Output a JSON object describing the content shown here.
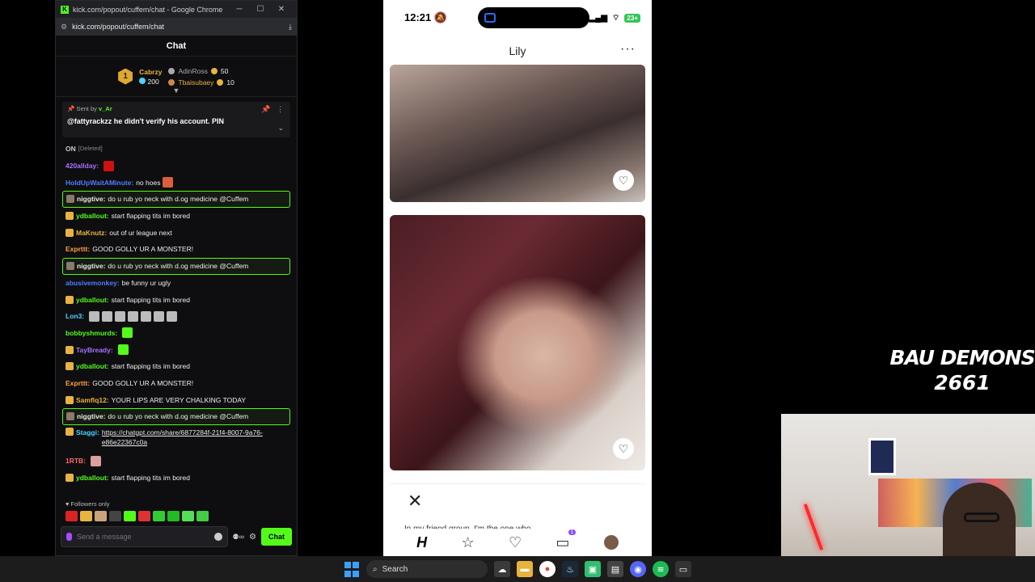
{
  "browser": {
    "window_title": "kick.com/popout/cuffem/chat - Google Chrome",
    "url": "kick.com/popout/cuffem/chat"
  },
  "chat": {
    "header": "Chat",
    "gifters": {
      "top": {
        "rank": "1",
        "name": "Cabrzy",
        "count": "200"
      },
      "others": [
        {
          "name": "AdinRoss",
          "count": "50"
        },
        {
          "name": "Tbaisubaey",
          "count": "10"
        }
      ]
    },
    "pinned": {
      "sent_by_label": "Sent by",
      "sent_by": "v_Ar",
      "text": "@fattyrackzz he didn't verify his account. PIN"
    },
    "messages": [
      {
        "user": "ON",
        "text": "[Deleted]",
        "color": "#cccccc"
      },
      {
        "user": "420allday:",
        "text": "",
        "color": "#a970ff"
      },
      {
        "user": "HoldUpWaitAMinute:",
        "text": "no hoes",
        "color": "#4f7cff"
      },
      {
        "user": "niggtive:",
        "text": "do u rub yo neck with d.og medicine @Cuffem",
        "color": "#e8e8e8",
        "highlight": true
      },
      {
        "user": "ydballout:",
        "text": "start flapping tits im bored",
        "color": "#53fc18"
      },
      {
        "user": "MaKnutz:",
        "text": "out of ur league next",
        "color": "#e7b342"
      },
      {
        "user": "Exprttt:",
        "text": "GOOD GOLLY UR A MONSTER!",
        "color": "#ff9f43"
      },
      {
        "user": "niggtive:",
        "text": "do u rub yo neck with d.og medicine @Cuffem",
        "color": "#e8e8e8",
        "highlight": true
      },
      {
        "user": "abusivemonkey:",
        "text": "be funny ur ugly",
        "color": "#4f7cff"
      },
      {
        "user": "ydballout:",
        "text": "start flapping tits im bored",
        "color": "#53fc18"
      },
      {
        "user": "Lon3:",
        "text": "",
        "color": "#4fd1ff"
      },
      {
        "user": "bobbyshmurds:",
        "text": "",
        "color": "#53fc18"
      },
      {
        "user": "TayBready:",
        "text": "",
        "color": "#a970ff"
      },
      {
        "user": "ydballout:",
        "text": "start flapping tits im bored",
        "color": "#53fc18"
      },
      {
        "user": "Exprttt:",
        "text": "GOOD GOLLY UR A MONSTER!",
        "color": "#ff9f43"
      },
      {
        "user": "Samflq12:",
        "text": "YOUR LIPS ARE VERY CHALKING TODAY",
        "color": "#e7b342"
      },
      {
        "user": "niggtive:",
        "text": "do u rub yo neck with d.og medicine @Cuffem",
        "color": "#e8e8e8",
        "highlight": true
      },
      {
        "user": "Staggi:",
        "text": "https://chatgpt.com/share/6877284f-21f4-8007-9a76-e86e22367c0a",
        "color": "#4fd1ff",
        "link": true
      },
      {
        "user": "1RTB:",
        "text": "",
        "color": "#ff6b6b"
      },
      {
        "user": "ydballout:",
        "text": "start flapping tits im bored",
        "color": "#53fc18"
      }
    ],
    "followers_only": "Followers only",
    "input_placeholder": "Send a message",
    "send_button": "Chat"
  },
  "phone": {
    "time": "12:21",
    "battery": "23+",
    "profile_name": "Lily",
    "more": "···",
    "prompt_text": "In my friend group, I'm the one who..."
  },
  "overlay": {
    "goal_title": "BAU DEMONS",
    "goal_count": "2661"
  },
  "taskbar": {
    "search_label": "Search"
  }
}
